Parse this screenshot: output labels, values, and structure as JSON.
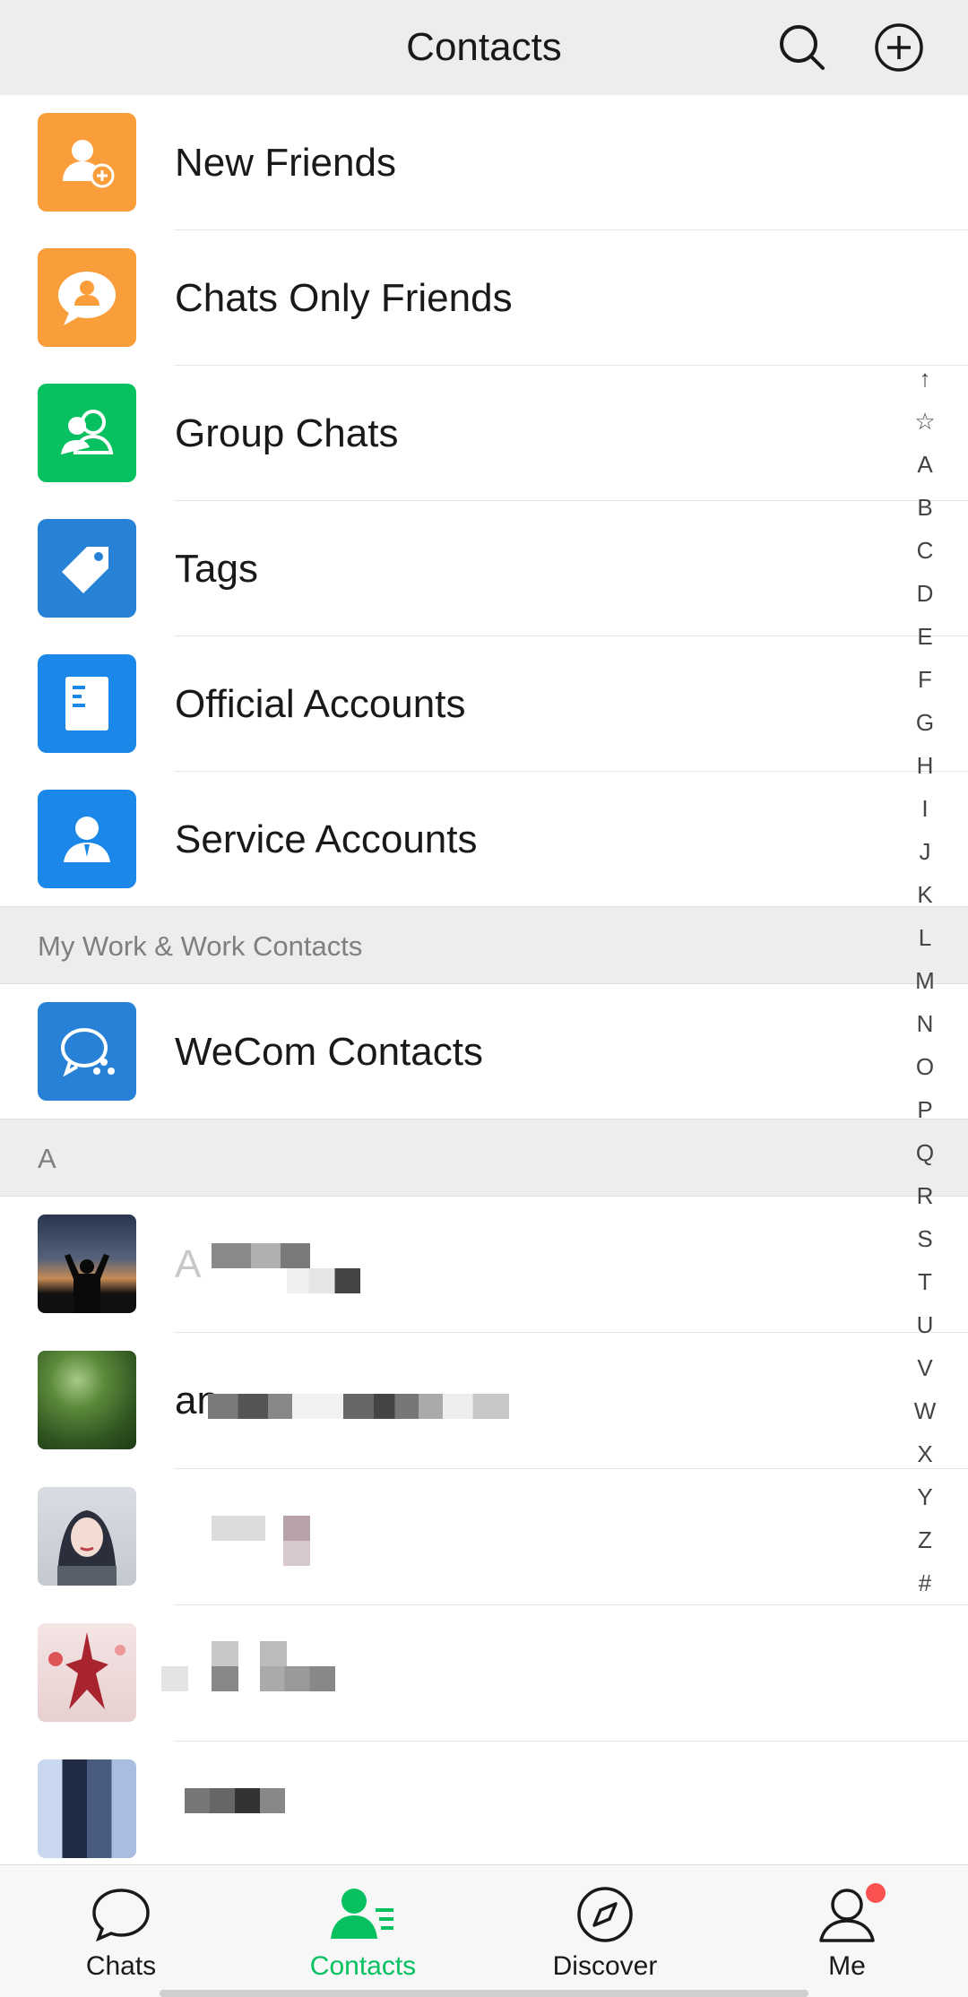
{
  "header": {
    "title": "Contacts"
  },
  "menu": [
    {
      "label": "New Friends",
      "color": "#fa9d3b",
      "icon": "person-add-icon"
    },
    {
      "label": "Chats Only Friends",
      "color": "#fa9d3b",
      "icon": "chat-person-icon"
    },
    {
      "label": "Group Chats",
      "color": "#07c160",
      "icon": "group-icon"
    },
    {
      "label": "Tags",
      "color": "#2782d7",
      "icon": "tag-icon"
    },
    {
      "label": "Official Accounts",
      "color": "#1b87e8",
      "icon": "document-icon"
    },
    {
      "label": "Service Accounts",
      "color": "#1b87e8",
      "icon": "service-person-icon"
    }
  ],
  "section_work": "My Work & Work Contacts",
  "wecom": {
    "label": "WeCom Contacts",
    "color": "#2782d7",
    "icon": "wecom-icon"
  },
  "section_a": "A",
  "contacts": [
    {
      "name": "A"
    },
    {
      "name": "an"
    },
    {
      "name": ""
    },
    {
      "name": ""
    },
    {
      "name": ""
    }
  ],
  "index": [
    "↑",
    "☆",
    "A",
    "B",
    "C",
    "D",
    "E",
    "F",
    "G",
    "H",
    "I",
    "J",
    "K",
    "L",
    "M",
    "N",
    "O",
    "P",
    "Q",
    "R",
    "S",
    "T",
    "U",
    "V",
    "W",
    "X",
    "Y",
    "Z",
    "#"
  ],
  "tabs": [
    {
      "label": "Chats",
      "icon": "chat-bubble-icon"
    },
    {
      "label": "Contacts",
      "icon": "contacts-icon",
      "active": true
    },
    {
      "label": "Discover",
      "icon": "compass-icon"
    },
    {
      "label": "Me",
      "icon": "person-icon"
    }
  ],
  "accent": "#07c160"
}
